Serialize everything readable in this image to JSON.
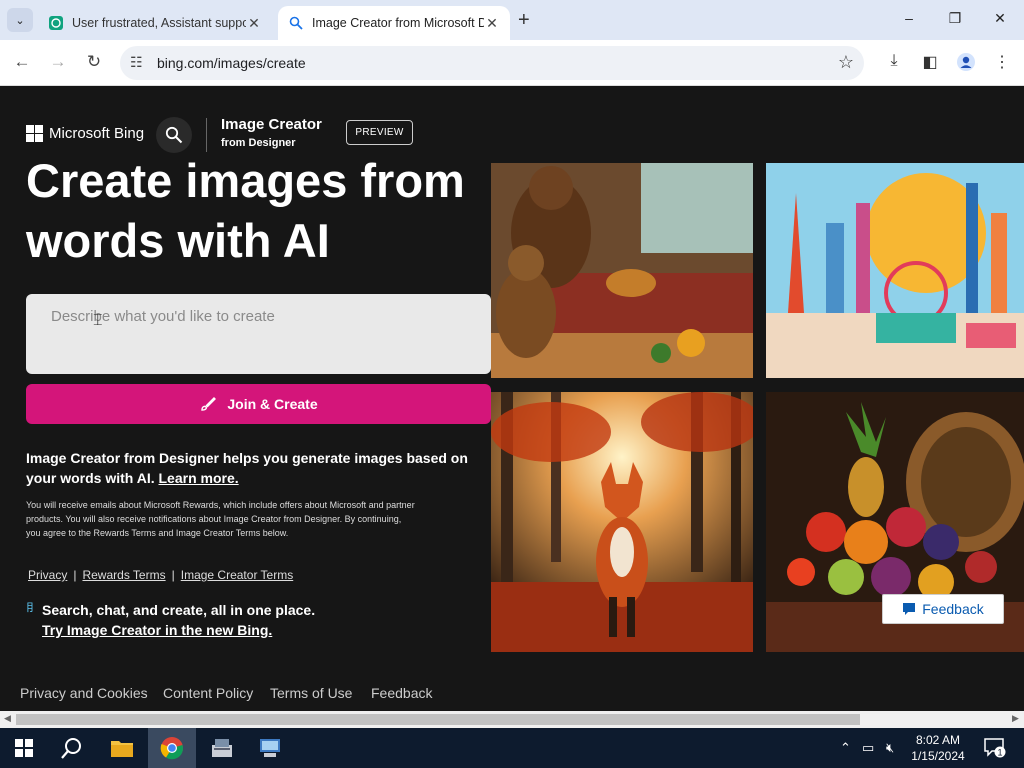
{
  "browser": {
    "tabs": [
      {
        "title": "User frustrated, Assistant suppo",
        "active": false
      },
      {
        "title": "Image Creator from Microsoft D",
        "active": true
      }
    ],
    "url": "bing.com/images/create"
  },
  "header": {
    "brand": "Microsoft Bing",
    "product_title": "Image Creator",
    "product_subtitle": "from Designer",
    "badge": "PREVIEW"
  },
  "hero": {
    "headline": "Create images from words with AI",
    "prompt_placeholder": "Describe what you'd like to create",
    "create_button": "Join & Create"
  },
  "info": {
    "text": "Image Creator from Designer helps you generate images based on your words with AI.",
    "learn_more": "Learn more.",
    "fine_print": "You will receive emails about Microsoft Rewards, which include offers about Microsoft and partner products. You will also receive notifications about Image Creator from Designer. By continuing, you agree to the Rewards Terms and Image Creator Terms below."
  },
  "legal_links": [
    "Privacy",
    "Rewards Terms",
    "Image Creator Terms"
  ],
  "promo": {
    "line1": "Search, chat, and create, all in one place.",
    "line2": "Try Image Creator in the new Bing."
  },
  "gallery": [
    {
      "subject": "bears in a cozy cabin feast"
    },
    {
      "subject": "colorful city skyline with ferris wheel"
    },
    {
      "subject": "fox walking in autumn forest"
    },
    {
      "subject": "cornucopia of fruits"
    }
  ],
  "footer": {
    "links": [
      "Privacy and Cookies",
      "Content Policy",
      "Terms of Use",
      "Feedback"
    ],
    "feedback_button": "Feedback"
  },
  "taskbar": {
    "time": "8:02 AM",
    "date": "1/15/2024",
    "notification_count": "1"
  },
  "colors": {
    "accent": "#d4157a",
    "page_bg": "#161616"
  }
}
